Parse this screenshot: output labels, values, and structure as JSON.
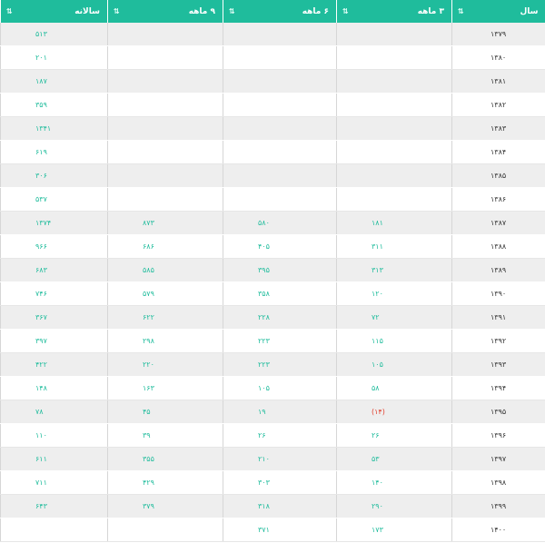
{
  "headers": {
    "year": "سال",
    "m3": "۳ ماهه",
    "m6": "۶ ماهه",
    "m9": "۹ ماهه",
    "annual": "سالانه"
  },
  "sort_icon": "⇅",
  "rows": [
    {
      "year": "۱۳۷۹",
      "m3": "",
      "m6": "",
      "m9": "",
      "annual": "۵۱۳"
    },
    {
      "year": "۱۳۸۰",
      "m3": "",
      "m6": "",
      "m9": "",
      "annual": "۲۰۱"
    },
    {
      "year": "۱۳۸۱",
      "m3": "",
      "m6": "",
      "m9": "",
      "annual": "۱۸۷"
    },
    {
      "year": "۱۳۸۲",
      "m3": "",
      "m6": "",
      "m9": "",
      "annual": "۳۵۹"
    },
    {
      "year": "۱۳۸۳",
      "m3": "",
      "m6": "",
      "m9": "",
      "annual": "۱۳۴۱"
    },
    {
      "year": "۱۳۸۴",
      "m3": "",
      "m6": "",
      "m9": "",
      "annual": "۶۱۹"
    },
    {
      "year": "۱۳۸۵",
      "m3": "",
      "m6": "",
      "m9": "",
      "annual": "۳۰۶"
    },
    {
      "year": "۱۳۸۶",
      "m3": "",
      "m6": "",
      "m9": "",
      "annual": "۵۳۷"
    },
    {
      "year": "۱۳۸۷",
      "m3": "۱۸۱",
      "m6": "۵۸۰",
      "m9": "۸۷۳",
      "annual": "۱۳۷۴"
    },
    {
      "year": "۱۳۸۸",
      "m3": "۳۱۱",
      "m6": "۴۰۵",
      "m9": "۶۸۶",
      "annual": "۹۶۶"
    },
    {
      "year": "۱۳۸۹",
      "m3": "۳۱۳",
      "m6": "۳۹۵",
      "m9": "۵۸۵",
      "annual": "۶۸۳"
    },
    {
      "year": "۱۳۹۰",
      "m3": "۱۲۰",
      "m6": "۳۵۸",
      "m9": "۵۷۹",
      "annual": "۷۴۶"
    },
    {
      "year": "۱۳۹۱",
      "m3": "۷۲",
      "m6": "۲۲۸",
      "m9": "۶۲۲",
      "annual": "۳۶۷"
    },
    {
      "year": "۱۳۹۲",
      "m3": "۱۱۵",
      "m6": "۲۲۳",
      "m9": "۲۹۸",
      "annual": "۳۹۷"
    },
    {
      "year": "۱۳۹۳",
      "m3": "۱۰۵",
      "m6": "۲۲۳",
      "m9": "۲۲۰",
      "annual": "۴۲۲"
    },
    {
      "year": "۱۳۹۴",
      "m3": "۵۸",
      "m6": "۱۰۵",
      "m9": "۱۶۳",
      "annual": "۱۴۸"
    },
    {
      "year": "۱۳۹۵",
      "m3": "(۱۴)",
      "m3_negative": true,
      "m6": "۱۹",
      "m9": "۴۵",
      "annual": "۷۸"
    },
    {
      "year": "۱۳۹۶",
      "m3": "۲۶",
      "m6": "۲۶",
      "m9": "۳۹",
      "annual": "۱۱۰"
    },
    {
      "year": "۱۳۹۷",
      "m3": "۵۳",
      "m6": "۲۱۰",
      "m9": "۳۵۵",
      "annual": "۶۱۱"
    },
    {
      "year": "۱۳۹۸",
      "m3": "۱۴۰",
      "m6": "۳۰۳",
      "m9": "۴۲۹",
      "annual": "۷۱۱"
    },
    {
      "year": "۱۳۹۹",
      "m3": "۲۹۰",
      "m6": "۳۱۸",
      "m9": "۳۷۹",
      "annual": "۶۴۳"
    },
    {
      "year": "۱۴۰۰",
      "m3": "۱۷۳",
      "m6": "۳۷۱",
      "m9": "",
      "annual": ""
    }
  ],
  "colors": {
    "header_bg": "#1fbc9c",
    "value_text": "#1fbc9c",
    "negative_text": "#e2412f",
    "row_alt_bg": "#eeeeee"
  }
}
